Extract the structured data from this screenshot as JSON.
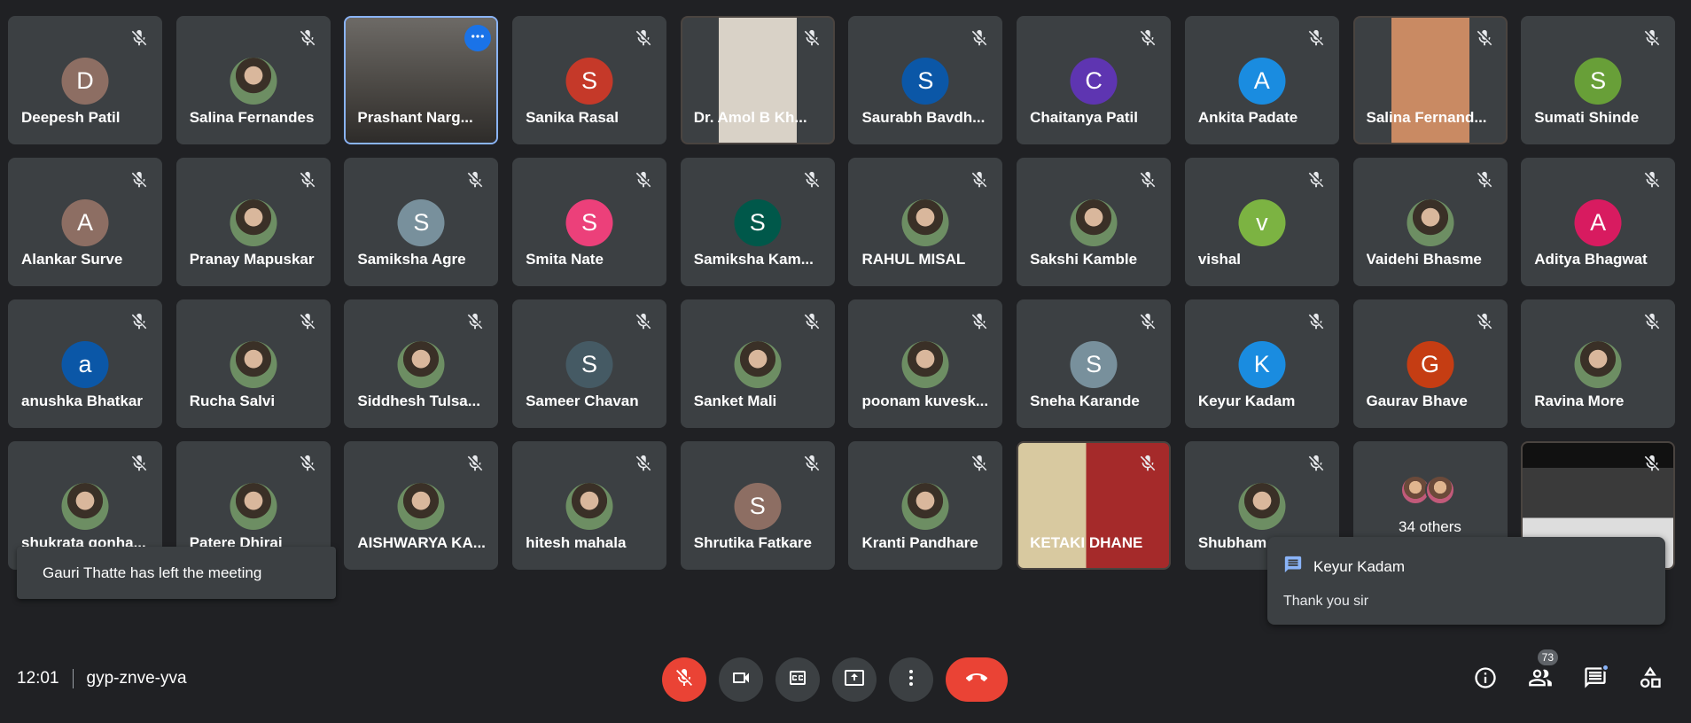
{
  "participants": [
    {
      "name": "Deepesh Patil",
      "initial": "D",
      "color": "#8d6e63",
      "type": "initial"
    },
    {
      "name": "Salina Fernandes",
      "type": "photo"
    },
    {
      "name": "Prashant Narg...",
      "type": "video",
      "active": true
    },
    {
      "name": "Sanika Rasal",
      "initial": "S",
      "color": "#c53929",
      "type": "initial"
    },
    {
      "name": "Dr. Amol B Kh...",
      "type": "video"
    },
    {
      "name": "Saurabh Bavdh...",
      "initial": "S",
      "color": "#0b57a7",
      "type": "initial"
    },
    {
      "name": "Chaitanya Patil",
      "initial": "C",
      "color": "#5e35b1",
      "type": "initial"
    },
    {
      "name": "Ankita Padate",
      "initial": "A",
      "color": "#1a8ce0",
      "type": "initial"
    },
    {
      "name": "Salina Fernand...",
      "type": "video"
    },
    {
      "name": "Sumati Shinde",
      "initial": "S",
      "color": "#689f38",
      "type": "initial"
    },
    {
      "name": "Alankar Surve",
      "initial": "A",
      "color": "#8d6e63",
      "type": "initial"
    },
    {
      "name": "Pranay Mapuskar",
      "type": "photo"
    },
    {
      "name": "Samiksha Agre",
      "initial": "S",
      "color": "#78909c",
      "type": "initial"
    },
    {
      "name": "Smita Nate",
      "initial": "S",
      "color": "#ec407a",
      "type": "initial"
    },
    {
      "name": "Samiksha Kam...",
      "initial": "S",
      "color": "#00584a",
      "type": "initial"
    },
    {
      "name": "RAHUL MISAL",
      "type": "photo"
    },
    {
      "name": "Sakshi Kamble",
      "type": "photo"
    },
    {
      "name": "vishal",
      "initial": "v",
      "color": "#7cb342",
      "type": "initial"
    },
    {
      "name": "Vaidehi Bhasme",
      "type": "photo"
    },
    {
      "name": "Aditya Bhagwat",
      "initial": "A",
      "color": "#d81b60",
      "type": "initial"
    },
    {
      "name": "anushka Bhatkar",
      "initial": "a",
      "color": "#0b57a7",
      "type": "initial"
    },
    {
      "name": "Rucha Salvi",
      "type": "photo"
    },
    {
      "name": "Siddhesh Tulsa...",
      "type": "photo"
    },
    {
      "name": "Sameer Chavan",
      "initial": "S",
      "color": "#455a64",
      "type": "initial"
    },
    {
      "name": "Sanket Mali",
      "type": "photo"
    },
    {
      "name": "poonam kuvesk...",
      "type": "photo"
    },
    {
      "name": "Sneha Karande",
      "initial": "S",
      "color": "#78909c",
      "type": "initial"
    },
    {
      "name": "Keyur Kadam",
      "initial": "K",
      "color": "#1a8ce0",
      "type": "initial"
    },
    {
      "name": "Gaurav Bhave",
      "initial": "G",
      "color": "#c53d13",
      "type": "initial"
    },
    {
      "name": "Ravina More",
      "type": "photo"
    },
    {
      "name": "shukrata gonha...",
      "type": "photo"
    },
    {
      "name": "Patere Dhiraj",
      "type": "photo"
    },
    {
      "name": "AISHWARYA KA...",
      "type": "photo"
    },
    {
      "name": "hitesh mahala",
      "type": "photo"
    },
    {
      "name": "Shrutika Fatkare",
      "initial": "S",
      "color": "#8d6e63",
      "type": "initial"
    },
    {
      "name": "Kranti Pandhare",
      "type": "photo"
    },
    {
      "name": "KETAKI DHANE",
      "type": "video"
    },
    {
      "name": "Shubham",
      "type": "photo"
    },
    {
      "name": "",
      "type": "others",
      "label": "34 others"
    },
    {
      "name": "",
      "type": "video"
    }
  ],
  "toast": {
    "text": "Gauri Thatte has left the meeting"
  },
  "chat_popup": {
    "sender": "Keyur Kadam",
    "message": "Thank you sir"
  },
  "meeting": {
    "time": "12:01",
    "code": "gyp-znve-yva"
  },
  "people_count": "73",
  "colors": {
    "hangup": "#ea4335",
    "active_border": "#8ab4f8",
    "tile_bg": "#3c4043"
  }
}
